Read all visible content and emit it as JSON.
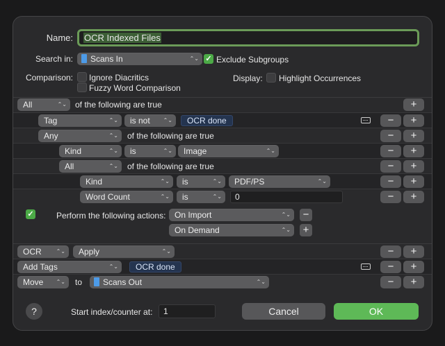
{
  "name": {
    "label": "Name:",
    "value": "OCR Indexed Files"
  },
  "search_in": {
    "label": "Search in:",
    "value": "Scans In",
    "exclude_label": "Exclude Subgroups",
    "exclude_checked": true
  },
  "comparison": {
    "label": "Comparison:",
    "options": [
      "Ignore Diacritics",
      "Fuzzy Word Comparison"
    ]
  },
  "display": {
    "label": "Display:",
    "option": "Highlight Occurrences"
  },
  "conditions": {
    "root": {
      "scope": "All",
      "text": "of the following are true"
    },
    "rows": [
      {
        "field": "Tag",
        "op": "is not",
        "value": "OCR done"
      },
      {
        "field": "Any",
        "text": "of the following are true"
      },
      {
        "field": "Kind",
        "op": "is",
        "value": "Image"
      },
      {
        "field": "All",
        "text": "of the following are true"
      },
      {
        "field": "Kind",
        "op": "is",
        "value": "PDF/PS"
      },
      {
        "field": "Word Count",
        "op": "is",
        "value": "0"
      }
    ]
  },
  "perform": {
    "label": "Perform the following actions:",
    "checked": true,
    "triggers": [
      "On Import",
      "On Demand"
    ]
  },
  "actions": [
    {
      "action": "OCR",
      "target": "Apply"
    },
    {
      "action": "Add Tags",
      "value": "OCR done"
    },
    {
      "action": "Move",
      "to_label": "to",
      "target": "Scans Out"
    }
  ],
  "footer": {
    "help": "?",
    "counter_label": "Start index/counter at:",
    "counter_value": "1",
    "cancel": "Cancel",
    "ok": "OK"
  },
  "symbols": {
    "plus": "+",
    "minus": "−",
    "chevron": "⌃⌄",
    "check": "✓"
  },
  "colors": {
    "accent_green": "#5eb957",
    "token_blue": "#24344f",
    "folder_blue": "#4d9be8"
  }
}
